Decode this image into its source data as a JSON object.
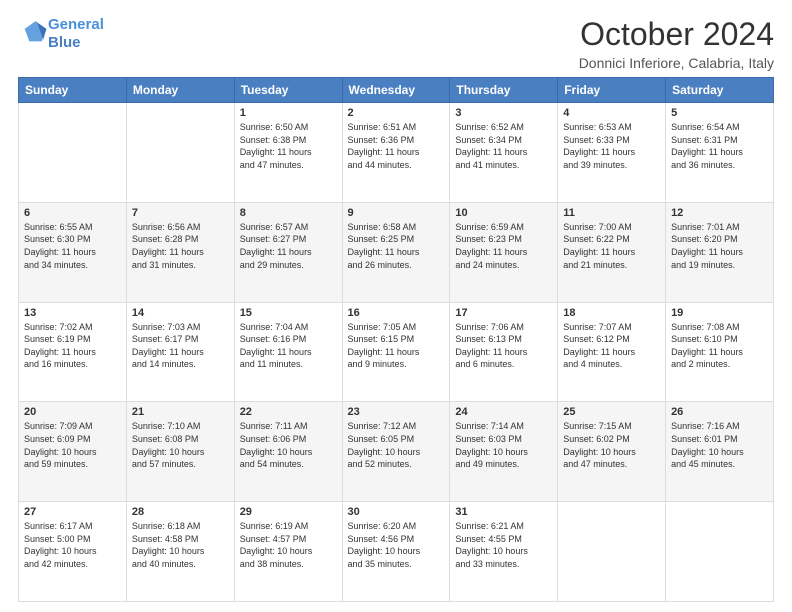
{
  "header": {
    "logo_line1": "General",
    "logo_line2": "Blue",
    "title": "October 2024",
    "subtitle": "Donnici Inferiore, Calabria, Italy"
  },
  "days_of_week": [
    "Sunday",
    "Monday",
    "Tuesday",
    "Wednesday",
    "Thursday",
    "Friday",
    "Saturday"
  ],
  "weeks": [
    [
      {
        "day": "",
        "info": ""
      },
      {
        "day": "",
        "info": ""
      },
      {
        "day": "1",
        "info": "Sunrise: 6:50 AM\nSunset: 6:38 PM\nDaylight: 11 hours\nand 47 minutes."
      },
      {
        "day": "2",
        "info": "Sunrise: 6:51 AM\nSunset: 6:36 PM\nDaylight: 11 hours\nand 44 minutes."
      },
      {
        "day": "3",
        "info": "Sunrise: 6:52 AM\nSunset: 6:34 PM\nDaylight: 11 hours\nand 41 minutes."
      },
      {
        "day": "4",
        "info": "Sunrise: 6:53 AM\nSunset: 6:33 PM\nDaylight: 11 hours\nand 39 minutes."
      },
      {
        "day": "5",
        "info": "Sunrise: 6:54 AM\nSunset: 6:31 PM\nDaylight: 11 hours\nand 36 minutes."
      }
    ],
    [
      {
        "day": "6",
        "info": "Sunrise: 6:55 AM\nSunset: 6:30 PM\nDaylight: 11 hours\nand 34 minutes."
      },
      {
        "day": "7",
        "info": "Sunrise: 6:56 AM\nSunset: 6:28 PM\nDaylight: 11 hours\nand 31 minutes."
      },
      {
        "day": "8",
        "info": "Sunrise: 6:57 AM\nSunset: 6:27 PM\nDaylight: 11 hours\nand 29 minutes."
      },
      {
        "day": "9",
        "info": "Sunrise: 6:58 AM\nSunset: 6:25 PM\nDaylight: 11 hours\nand 26 minutes."
      },
      {
        "day": "10",
        "info": "Sunrise: 6:59 AM\nSunset: 6:23 PM\nDaylight: 11 hours\nand 24 minutes."
      },
      {
        "day": "11",
        "info": "Sunrise: 7:00 AM\nSunset: 6:22 PM\nDaylight: 11 hours\nand 21 minutes."
      },
      {
        "day": "12",
        "info": "Sunrise: 7:01 AM\nSunset: 6:20 PM\nDaylight: 11 hours\nand 19 minutes."
      }
    ],
    [
      {
        "day": "13",
        "info": "Sunrise: 7:02 AM\nSunset: 6:19 PM\nDaylight: 11 hours\nand 16 minutes."
      },
      {
        "day": "14",
        "info": "Sunrise: 7:03 AM\nSunset: 6:17 PM\nDaylight: 11 hours\nand 14 minutes."
      },
      {
        "day": "15",
        "info": "Sunrise: 7:04 AM\nSunset: 6:16 PM\nDaylight: 11 hours\nand 11 minutes."
      },
      {
        "day": "16",
        "info": "Sunrise: 7:05 AM\nSunset: 6:15 PM\nDaylight: 11 hours\nand 9 minutes."
      },
      {
        "day": "17",
        "info": "Sunrise: 7:06 AM\nSunset: 6:13 PM\nDaylight: 11 hours\nand 6 minutes."
      },
      {
        "day": "18",
        "info": "Sunrise: 7:07 AM\nSunset: 6:12 PM\nDaylight: 11 hours\nand 4 minutes."
      },
      {
        "day": "19",
        "info": "Sunrise: 7:08 AM\nSunset: 6:10 PM\nDaylight: 11 hours\nand 2 minutes."
      }
    ],
    [
      {
        "day": "20",
        "info": "Sunrise: 7:09 AM\nSunset: 6:09 PM\nDaylight: 10 hours\nand 59 minutes."
      },
      {
        "day": "21",
        "info": "Sunrise: 7:10 AM\nSunset: 6:08 PM\nDaylight: 10 hours\nand 57 minutes."
      },
      {
        "day": "22",
        "info": "Sunrise: 7:11 AM\nSunset: 6:06 PM\nDaylight: 10 hours\nand 54 minutes."
      },
      {
        "day": "23",
        "info": "Sunrise: 7:12 AM\nSunset: 6:05 PM\nDaylight: 10 hours\nand 52 minutes."
      },
      {
        "day": "24",
        "info": "Sunrise: 7:14 AM\nSunset: 6:03 PM\nDaylight: 10 hours\nand 49 minutes."
      },
      {
        "day": "25",
        "info": "Sunrise: 7:15 AM\nSunset: 6:02 PM\nDaylight: 10 hours\nand 47 minutes."
      },
      {
        "day": "26",
        "info": "Sunrise: 7:16 AM\nSunset: 6:01 PM\nDaylight: 10 hours\nand 45 minutes."
      }
    ],
    [
      {
        "day": "27",
        "info": "Sunrise: 6:17 AM\nSunset: 5:00 PM\nDaylight: 10 hours\nand 42 minutes."
      },
      {
        "day": "28",
        "info": "Sunrise: 6:18 AM\nSunset: 4:58 PM\nDaylight: 10 hours\nand 40 minutes."
      },
      {
        "day": "29",
        "info": "Sunrise: 6:19 AM\nSunset: 4:57 PM\nDaylight: 10 hours\nand 38 minutes."
      },
      {
        "day": "30",
        "info": "Sunrise: 6:20 AM\nSunset: 4:56 PM\nDaylight: 10 hours\nand 35 minutes."
      },
      {
        "day": "31",
        "info": "Sunrise: 6:21 AM\nSunset: 4:55 PM\nDaylight: 10 hours\nand 33 minutes."
      },
      {
        "day": "",
        "info": ""
      },
      {
        "day": "",
        "info": ""
      }
    ]
  ]
}
